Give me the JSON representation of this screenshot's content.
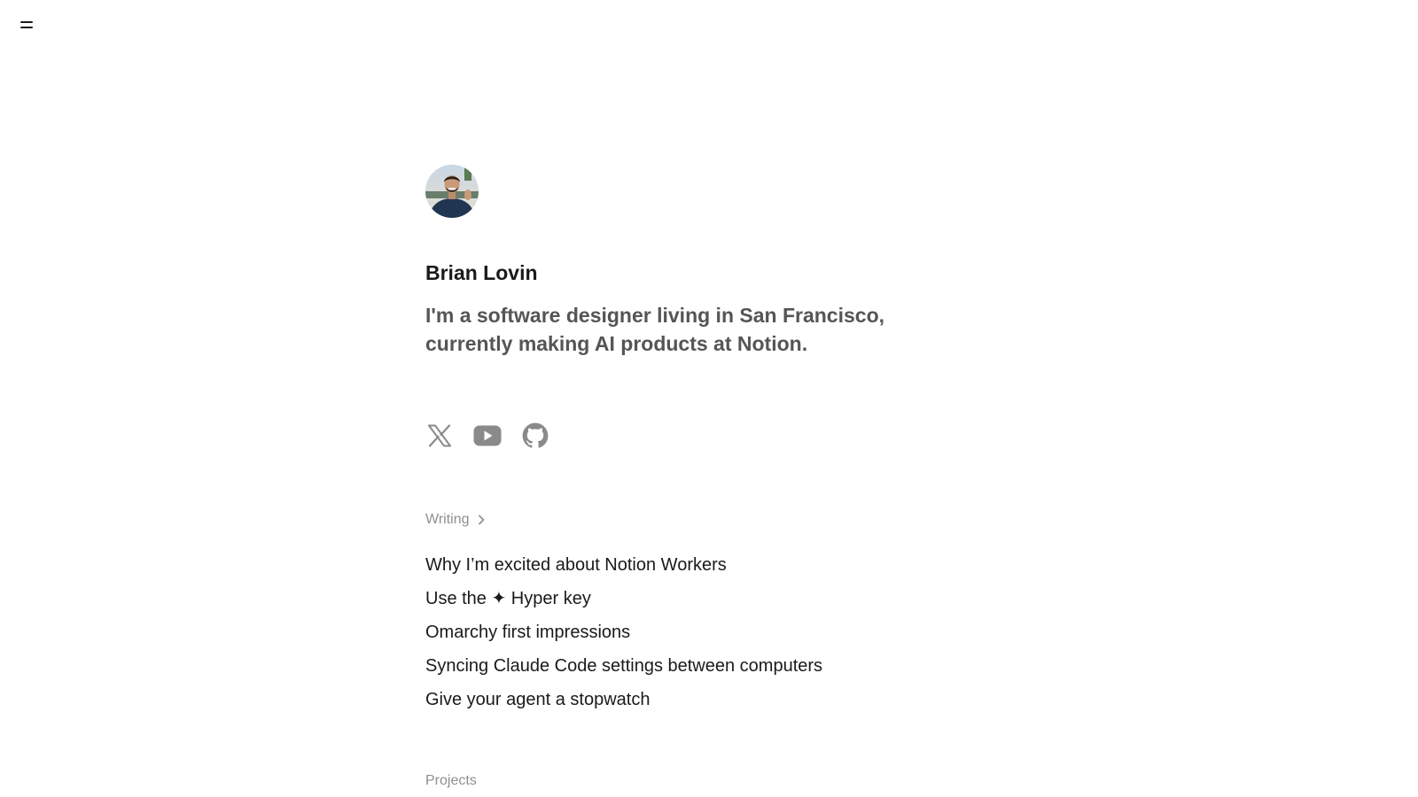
{
  "profile": {
    "name": "Brian Lovin",
    "bio": "I'm a software designer living in San Francisco, currently making AI products at Notion."
  },
  "socials": [
    {
      "icon": "x-icon",
      "label": "X"
    },
    {
      "icon": "youtube-icon",
      "label": "YouTube"
    },
    {
      "icon": "github-icon",
      "label": "GitHub"
    }
  ],
  "writing": {
    "label": "Writing",
    "posts": [
      "Why I’m excited about Notion Workers",
      "Use the ✦ Hyper key",
      "Omarchy first impressions",
      "Syncing Claude Code settings between computers",
      "Give your agent a stopwatch"
    ]
  },
  "projects": {
    "label": "Projects"
  },
  "colors": {
    "text": "#1a1a1a",
    "bio": "#555555",
    "muted": "#8f8f8f",
    "icon": "#8a8a8a"
  }
}
